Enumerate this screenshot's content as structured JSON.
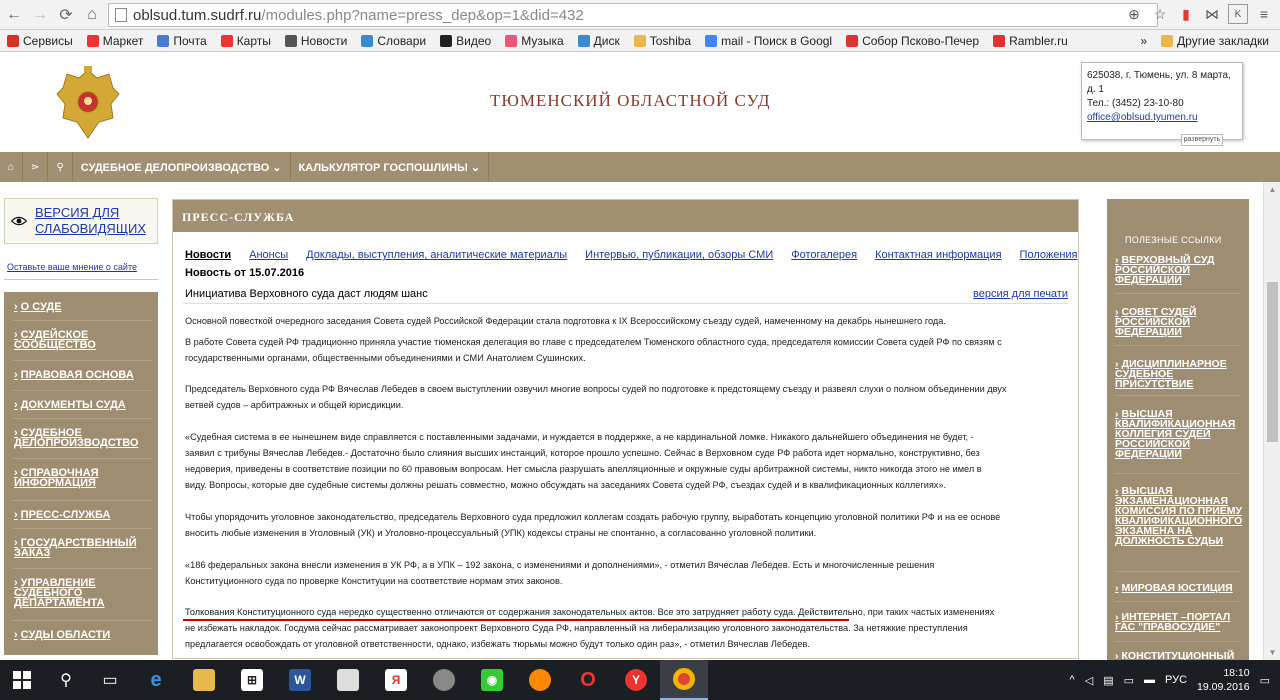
{
  "browser": {
    "url_host": "oblsud.tum.sudrf.ru",
    "url_path": "/modules.php?name=press_dep&op=1&did=432",
    "bookmarks": [
      {
        "label": "Сервисы",
        "color": "#d93025"
      },
      {
        "label": "Маркет",
        "color": "#e33"
      },
      {
        "label": "Почта",
        "color": "#4a7bd0"
      },
      {
        "label": "Карты",
        "color": "#e33"
      },
      {
        "label": "Новости",
        "color": "#555"
      },
      {
        "label": "Словари",
        "color": "#3a8ad0"
      },
      {
        "label": "Видео",
        "color": "#222"
      },
      {
        "label": "Музыка",
        "color": "#e57"
      },
      {
        "label": "Диск",
        "color": "#3a8ad0"
      },
      {
        "label": "Toshiba",
        "color": "#e8b84a"
      },
      {
        "label": "mail - Поиск в Googl",
        "color": "#4285f4"
      },
      {
        "label": "Собор Псково-Печер",
        "color": "#d33"
      },
      {
        "label": "Rambler.ru",
        "color": "#d33"
      }
    ],
    "bookmarks_more": "»",
    "other_bookmarks": "Другие закладки"
  },
  "header": {
    "title": "ТЮМЕНСКИЙ ОБЛАСТНОЙ СУД",
    "contact_address_1": "625038, г. Тюмень, ул. 8 марта,",
    "contact_address_2": "д. 1",
    "contact_phone": "Тел.: (3452) 23-10-80",
    "contact_email": "office@oblsud.tyumen.ru",
    "expand_label": "развернуть"
  },
  "topnav": {
    "items": [
      "СУДЕБНОЕ ДЕЛОПРОИЗВОДСТВО ⌄",
      "КАЛЬКУЛЯТОР ГОСПОШЛИНЫ ⌄"
    ]
  },
  "left": {
    "vision_label": "ВЕРСИЯ ДЛЯ СЛАБОВИДЯЩИХ",
    "feedback": "Оставьте ваше мнение о сайте",
    "nav": [
      "О СУДЕ",
      "СУДЕЙСКОЕ СООБЩЕСТВО",
      "ПРАВОВАЯ ОСНОВА",
      "ДОКУМЕНТЫ СУДА",
      "СУДЕБНОЕ ДЕЛОПРОИЗВОДСТВО",
      "СПРАВОЧНАЯ ИНФОРМАЦИЯ",
      "ПРЕСС-СЛУЖБА",
      "ГОСУДАРСТВЕННЫЙ ЗАКАЗ",
      "УПРАВЛЕНИЕ СУДЕБНОГО ДЕПАРТАМЕНТА",
      "СУДЫ ОБЛАСТИ"
    ]
  },
  "main": {
    "section_title": "ПРЕСС-СЛУЖБА",
    "tabs": [
      "Новости",
      "Анонсы",
      "Доклады, выступления, аналитические материалы",
      "Интервью, публикации, обзоры СМИ",
      "Фотогалерея",
      "Контактная информация",
      "Положения"
    ],
    "news_date": "Новость от 15.07.2016",
    "news_title": "Инициатива Верховного суда даст людям шанс",
    "print_link": "версия для печати",
    "paragraphs": [
      "Основной повесткой очередного заседания Совета судей Российской Федерации стала подготовка к IX Всероссийскому съезду судей, намеченному на декабрь нынешнего года.",
      "В работе Совета судей РФ традиционно приняла участие тюменская делегация во главе с председателем Тюменского областного суда, председателя комиссии Совета судей РФ по связям с",
      "государственными органами, общественными объединениями и СМИ Анатолием Сушинских.",
      "Председатель Верховного суда РФ Вячеслав Лебедев в своем выступлении озвучил многие вопросы судей по подготовке к предстоящему съезду и развеял слухи о полном объединении двух",
      "ветвей судов – арбитражных и общей юрисдикции.",
      "«Судебная система в ее нынешнем виде справляется с поставленными задачами, и нуждается в поддержке, а не кардинальной ломке. Никакого дальнейшего объединения не будет, -",
      "заявил с трибуны Вячеслав Лебедев.- Достаточно было слияния высших инстанций, которое прошло успешно. Сейчас в Верховном суде РФ работа идет нормально, конструктивно, без",
      "недоверия, приведены в соответствие позиции по 60 правовым вопросам. Нет смысла разрушать апелляционные и окружные суды арбитражной системы, никто никогда этого не имел в",
      "виду. Вопросы, которые две судебные системы должны решать совместно, можно обсуждать на заседаниях Совета судей РФ, съездах судей и в квалификационных коллегиях».",
      "Чтобы упорядочить уголовное законодательство, председатель Верховного суда предложил коллегам создать рабочую группу, выработать концепцию уголовной политики РФ и на ее основе",
      "вносить любые изменения в Уголовный (УК) и Уголовно-процессуальный (УПК) кодексы страны не спонтанно, а согласованно уголовной политики.",
      "«186 федеральных закона внесли изменения в УК РФ, а в УПК – 192 закона, с изменениями и дополнениями», - отметил Вячеслав Лебедев. Есть и многочисленные решения",
      "Конституционного суда по проверке Конституции на соответствие нормам этих законов.",
      "Толкования Конституционного суда нередко существенно отличаются от содержания законодательных актов. Все это затрудняет работу суда. Действительно, при таких частых изменениях",
      "не избежать накладок. Госдума сейчас рассматривает законопроект Верховного Суда РФ, направленный на либерализацию уголовного законодательства. За нетяжкие преступления",
      "предлагается освобождать от уголовной ответственности, однако, избежать тюрьмы можно будут только один раз», - отметил Вячеслав Лебедев."
    ]
  },
  "right": {
    "heading": "ПОЛЕЗНЫЕ ССЫЛКИ",
    "links": [
      "ВЕРХОВНЫЙ СУД РОССИЙСКОЙ ФЕДЕРАЦИИ",
      "СОВЕТ СУДЕЙ РОССИЙСКОЙ ФЕДЕРАЦИИ",
      "ДИСЦИПЛИНАРНОЕ СУДЕБНОЕ ПРИСУТСТВИЕ",
      "ВЫСШАЯ КВАЛИФИКАЦИОННАЯ КОЛЛЕГИЯ СУДЕЙ РОССИЙСКОЙ ФЕДЕРАЦИИ",
      "ВЫСШАЯ ЭКЗАМЕНАЦИОННАЯ КОМИССИЯ ПО ПРИЕМУ КВАЛИФИКАЦИОННОГО ЭКЗАМЕНА НА ДОЛЖНОСТЬ СУДЬИ",
      "МИРОВАЯ ЮСТИЦИЯ",
      "ИНТЕРНЕТ –ПОРТАЛ ГАС \"ПРАВОСУДИЕ\"",
      "КОНСТИТУЦИОННЫЙ"
    ]
  },
  "taskbar": {
    "lang": "РУС",
    "time": "18:10",
    "date": "19.09.2016"
  }
}
